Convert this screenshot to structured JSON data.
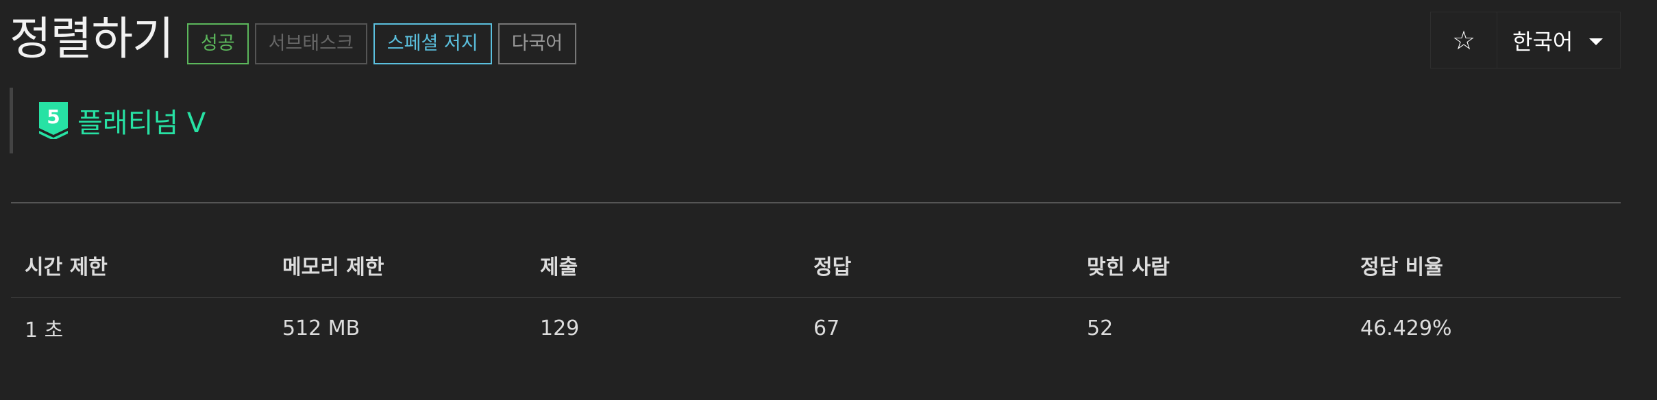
{
  "problem": {
    "title": "정렬하기",
    "badges": {
      "success": "성공",
      "subtask": "서브태스크",
      "special": "스페셜 저지",
      "multilang": "다국어"
    },
    "tier": {
      "level": "5",
      "label": "플래티넘 V",
      "color": "#27e2a4"
    }
  },
  "toolbar": {
    "star": "☆",
    "language": "한국어"
  },
  "info_table": {
    "headers": [
      "시간 제한",
      "메모리 제한",
      "제출",
      "정답",
      "맞힌 사람",
      "정답 비율"
    ],
    "row": [
      "1 초",
      "512 MB",
      "129",
      "67",
      "52",
      "46.429%"
    ]
  }
}
